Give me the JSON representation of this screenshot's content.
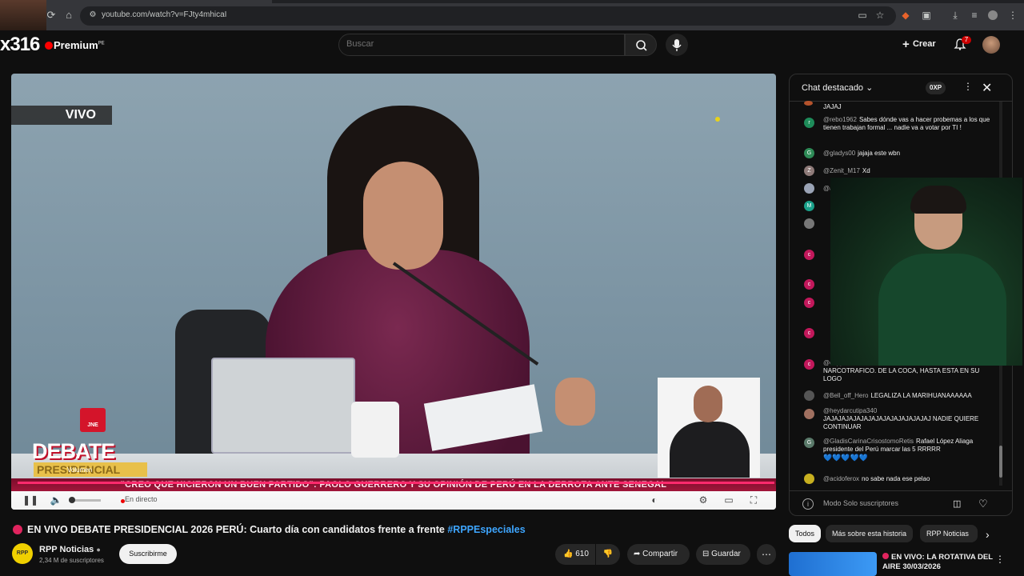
{
  "browser": {
    "url": "youtube.com/watch?v=FJty4mhicaI"
  },
  "header": {
    "overlay_tag": "x316",
    "brand": "Premium",
    "region": "PE",
    "search_placeholder": "Buscar",
    "create_label": "Crear",
    "notification_count": "7"
  },
  "player": {
    "live_badge": "VIVO",
    "logo_top": "JNE",
    "logo_title": "DEBATE",
    "logo_subtitle": "PRESIDENCIAL",
    "volume_tooltip": "Volumen",
    "ticker": "\"CREO QUE HICIERON UN BUEN PARTIDO\": PAOLO GUERRERO Y SU OPINIÓN DE PERÚ EN LA DERROTA ANTE SENEGAL",
    "live_status": "En directo"
  },
  "video": {
    "title": "EN VIVO DEBATE PRESIDENCIAL 2026 PERÚ: Cuarto día con candidatos frente a frente",
    "hashtag": "#RPPEspeciales",
    "channel_logo": "RPP",
    "channel_name": "RPP Noticias",
    "subscribers": "2,34 M de suscriptores",
    "subscribe_label": "Suscribirme",
    "likes": "610",
    "share_label": "Compartir",
    "save_label": "Guardar"
  },
  "chat": {
    "title": "Chat destacado",
    "xp": "0XP",
    "messages": [
      {
        "author": "",
        "text": "JAJAJ",
        "initial": "",
        "color": "#b5532c"
      },
      {
        "author": "@rebo1962",
        "text": "Sabes dónde vas a hacer probemas a los que tienen trabajan formal ... nadie va a votar por TI !",
        "initial": "r",
        "color": "#1e8c5a"
      },
      {
        "author": "@gladys00",
        "text": "jajaja este wbn",
        "initial": "G",
        "color": "#2e8b57"
      },
      {
        "author": "@Zenit_M17",
        "text": "Xd",
        "initial": "Z",
        "color": "#8e7a78"
      },
      {
        "author": "@alej",
        "text": "",
        "initial": "",
        "color": "#9aa3b5"
      },
      {
        "author": "@",
        "text": "",
        "initial": "M",
        "color": "#1aa08a"
      },
      {
        "author": "@cappe",
        "text": "NARCOTRAFICO. DE LA COCA, HASTA ESTA EN SU LOGO",
        "initial": "c",
        "color": "#c2185b"
      },
      {
        "author": "@Bell_off_Hero",
        "text": "LEGALIZA LA MARIHUANAAAAAA",
        "initial": "",
        "color": "#555"
      },
      {
        "author": "@heydarcutipa340",
        "text": "JAJAJAJAJAJAJAJAJAJAJAJAJAJAJ NADIE QUIERE CONTINUAR",
        "initial": "",
        "color": "#a07060"
      },
      {
        "author": "@GladisCarinaCrisostomoRetis",
        "text": "Rafael López Aliaga presidente del Perú marcar las 5 RRRRR",
        "initial": "G",
        "color": "#5a7a6a"
      },
      {
        "author": "@acidoferox",
        "text": "no sabe nada ese pelao",
        "initial": "",
        "color": "#c8b020"
      }
    ],
    "hearts": "💙💙💙💙💙",
    "footer": "Modo Solo suscriptores"
  },
  "related": {
    "tabs": [
      "Todos",
      "Más sobre esta historia",
      "RPP Noticias"
    ],
    "first_title": "EN VIVO: LA ROTATIVA DEL AIRE 30/03/2026"
  }
}
